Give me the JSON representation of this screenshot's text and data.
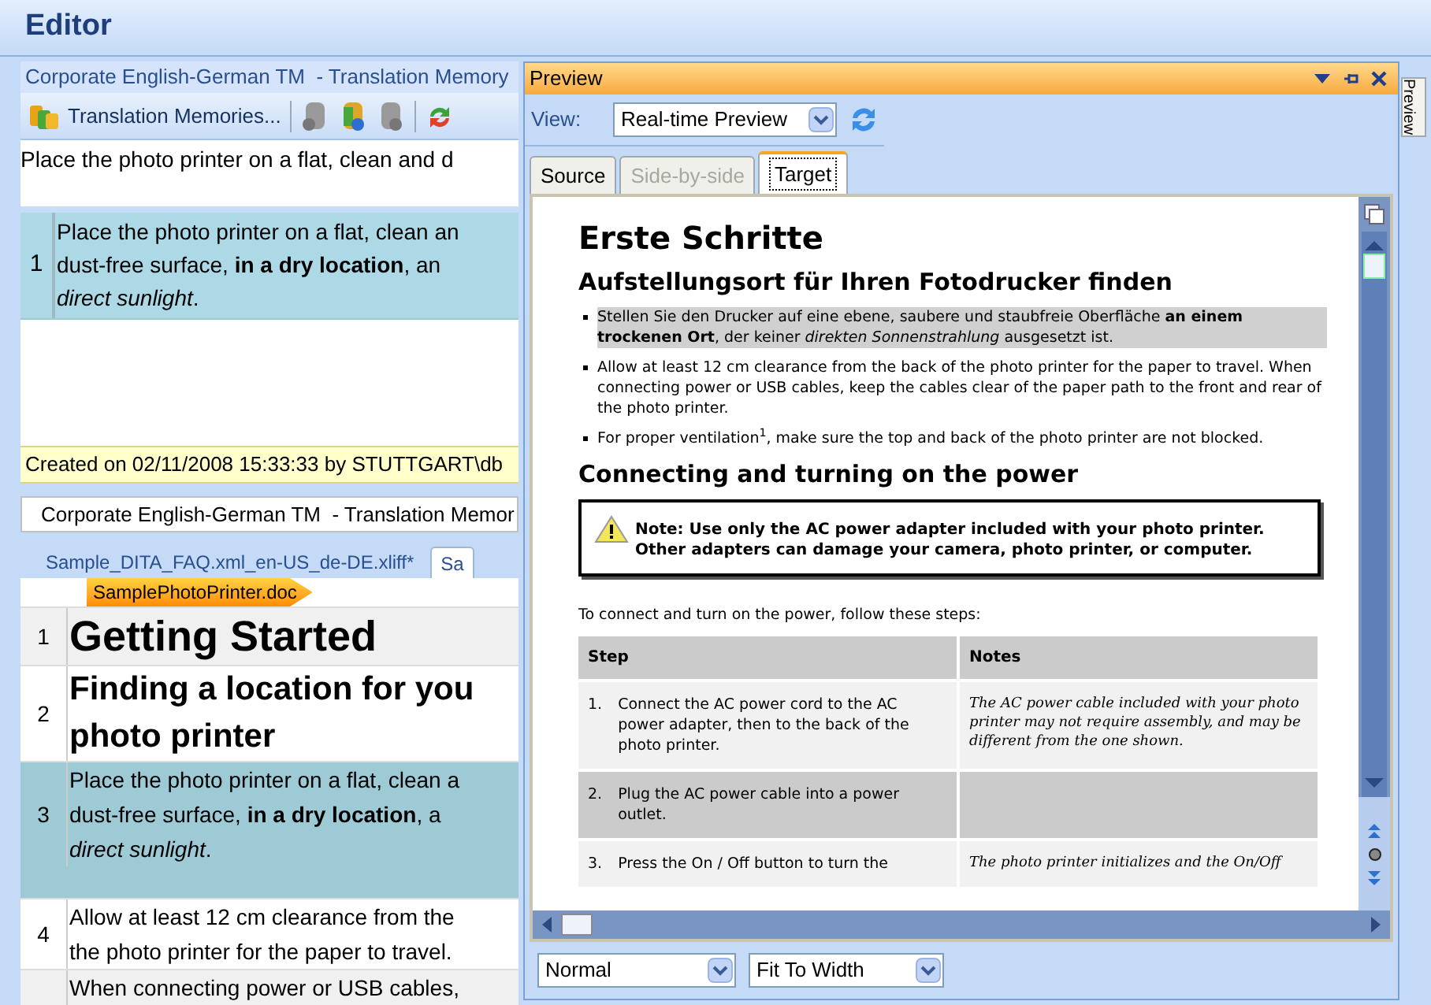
{
  "window": {
    "title": "Editor"
  },
  "tm_panel": {
    "title": "Corporate English-German TM  - Translation Memory",
    "toolbar_button": "Translation Memories...",
    "source_text": "Place the photo printer on a flat, clean and d",
    "results": [
      {
        "number": "1",
        "text": "Place the photo printer on a flat, clean an\ndust-free surface, **in a dry location**, an\n*direct sunlight*."
      }
    ],
    "status": "Created on 02/11/2008 15:33:33 by STUTTGART\\db"
  },
  "tm_tab": {
    "label": "Corporate English-German TM  - Translation Memor"
  },
  "document_tabs": [
    {
      "label": "Sample_DITA_FAQ.xml_en-US_de-DE.xliff*",
      "selected": false
    },
    {
      "label": "Sa",
      "selected": true
    }
  ],
  "document_tag": "SamplePhotoPrinter.doc",
  "segments": [
    {
      "number": "1",
      "kind": "heading1",
      "text": "Getting Started",
      "selected": false
    },
    {
      "number": "2",
      "kind": "heading2",
      "text": "Finding a location for you\nphoto printer",
      "selected": false
    },
    {
      "number": "3",
      "kind": "body",
      "text": "Place the photo printer on a flat, clean a\ndust-free surface, **in a dry location**, a\n*direct sunlight*.",
      "selected": true
    },
    {
      "number": "4",
      "kind": "body",
      "text": "Allow at least 12 cm clearance from the\nthe photo printer for the paper to travel.",
      "selected": false
    },
    {
      "kind": "body",
      "text": "When connecting power or USB cables,",
      "selected": false
    }
  ],
  "preview": {
    "title": "Preview",
    "view_label": "View:",
    "view_value": "Real-time Preview",
    "tabs": [
      {
        "label": "Source",
        "selected": false,
        "disabled": false
      },
      {
        "label": "Side-by-side",
        "selected": false,
        "disabled": true
      },
      {
        "label": "Target",
        "selected": true,
        "disabled": false
      }
    ],
    "document": {
      "heading": "Erste Schritte",
      "subheading": "Aufstellungsort für Ihren Fotodrucker finden",
      "bullets": [
        {
          "text": "Stellen Sie den Drucker auf eine ebene, saubere und staubfreie Oberfläche **an einem trockenen Ort**, der keiner *direkten Sonnenstrahlung* ausgesetzt ist.",
          "highlighted": true
        },
        {
          "text": "Allow at least 12 cm clearance from the back of the photo printer for the paper to travel. When connecting power or USB cables, keep the cables clear of the paper path to the front and rear of the photo printer.",
          "highlighted": false
        },
        {
          "text": "For proper ventilation$^{1}$, make sure the top and back of the photo printer are not blocked.",
          "highlighted": false
        }
      ],
      "section_heading": "Connecting and turning on the power",
      "note": "Note: Use only the AC power adapter included with your photo printer. Other adapters can damage your camera, photo printer, or computer.",
      "intro": "To connect and turn on the power, follow these steps:",
      "table": {
        "columns": [
          "Step",
          "Notes"
        ],
        "rows": [
          {
            "number": "1.",
            "step": "Connect the AC power cord to the AC power adapter, then to the back of the photo printer.",
            "notes": "The AC power cable included with your photo printer may not require assembly, and may be different from the one shown."
          },
          {
            "number": "2.",
            "step": "Plug the AC power cable into a power outlet."
          },
          {
            "number": "3.",
            "step": "Press the On / Off button to turn the",
            "notes": "The photo printer initializes and the On/Off"
          }
        ]
      }
    },
    "zoom_select": "Normal",
    "fit_select": "Fit To Width",
    "side_tab": "Preview"
  }
}
